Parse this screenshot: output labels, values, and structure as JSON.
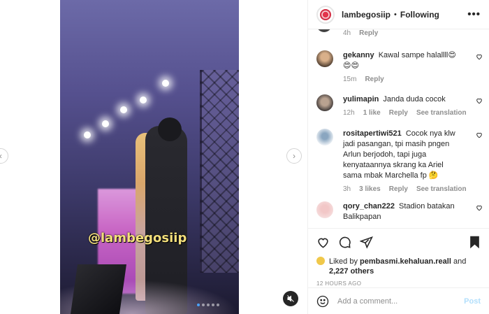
{
  "media": {
    "watermark": "@lambegosiip",
    "prev_arrow": "‹",
    "next_arrow": "›",
    "mute_icon": "speaker-muted-icon"
  },
  "header": {
    "username": "lambegosiip",
    "separator": "•",
    "follow_status": "Following",
    "more": "•••"
  },
  "comments": {
    "top_partial": {
      "time": "4h",
      "reply": "Reply"
    },
    "items": [
      {
        "username": "gekanny",
        "text": "Kawal sampe halallll😍😍😍",
        "time": "15m",
        "likes": "",
        "reply": "Reply",
        "translation": ""
      },
      {
        "username": "yulimapin",
        "text": "Janda duda cocok",
        "time": "12h",
        "likes": "1 like",
        "reply": "Reply",
        "translation": "See translation"
      },
      {
        "username": "rositapertiwi521",
        "text": "Cocok nya klw jadi pasangan, tpi masih pngen Arlun berjodoh, tapi juga kenyataannya skrang ka Ariel sama mbak Marchella fp 🤔",
        "time": "3h",
        "likes": "3 likes",
        "reply": "Reply",
        "translation": "See translation"
      },
      {
        "username": "qory_chan222",
        "text": "Stadion batakan Balikpapan",
        "time": "",
        "likes": "",
        "reply": "",
        "translation": ""
      }
    ]
  },
  "likes": {
    "prefix": "Liked by",
    "user": "pembasmi.kehaluan.reall",
    "and": "and",
    "others": "2,227 others"
  },
  "timestamp": "12 HOURS AGO",
  "add_comment": {
    "placeholder": "Add a comment...",
    "post_label": "Post"
  }
}
